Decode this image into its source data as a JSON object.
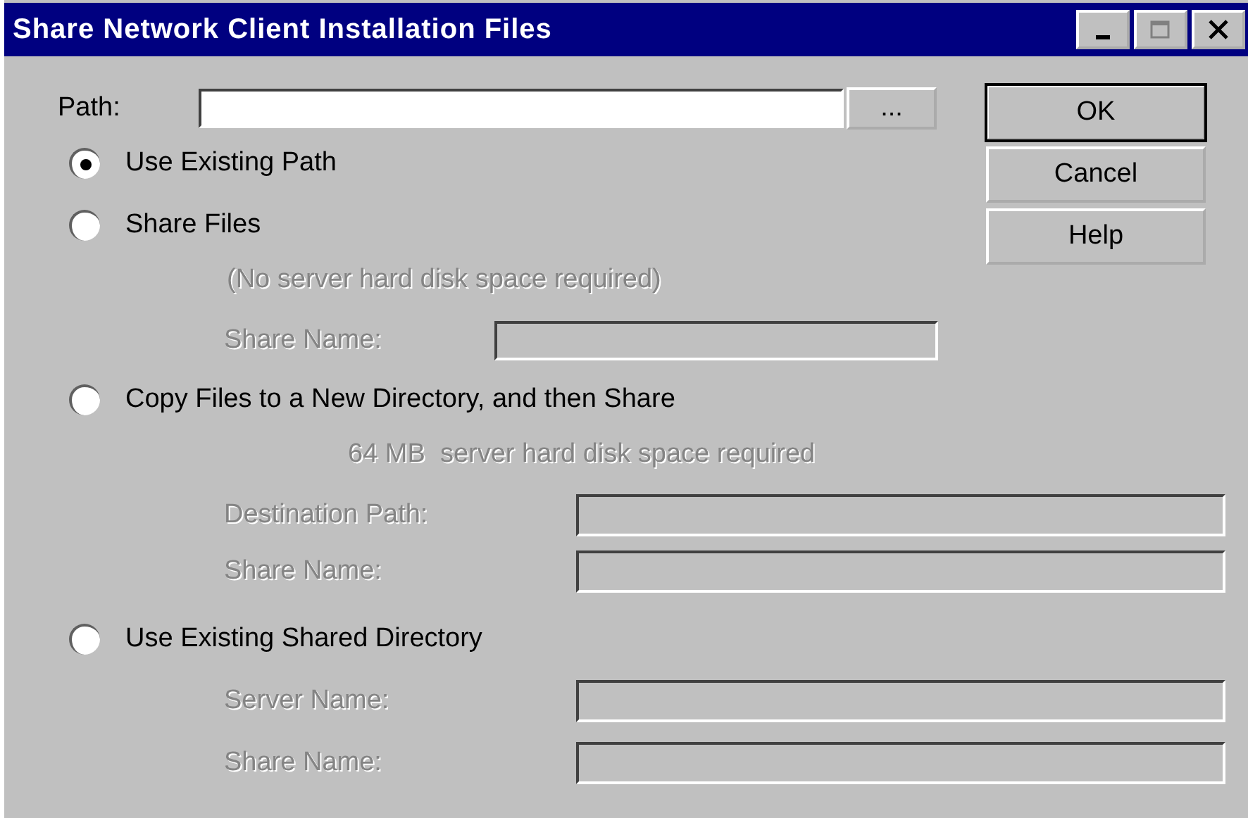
{
  "window": {
    "title": "Share Network Client Installation Files"
  },
  "path": {
    "label": "Path:",
    "browse_button": "..."
  },
  "options": [
    {
      "label": "Use Existing Path",
      "selected": true
    },
    {
      "label": "Share Files",
      "selected": false,
      "note": "(No server hard disk space required)",
      "fields": [
        {
          "label": "Share Name:",
          "disabled": true
        }
      ]
    },
    {
      "label": "Copy Files to a New Directory, and then Share",
      "selected": false,
      "note": "64 MB  server hard disk space required",
      "fields": [
        {
          "label": "Destination Path:",
          "disabled": true
        },
        {
          "label": "Share Name:",
          "disabled": true
        }
      ]
    },
    {
      "label": "Use Existing Shared Directory",
      "selected": false,
      "fields": [
        {
          "label": "Server Name:",
          "disabled": true
        },
        {
          "label": "Share Name:",
          "disabled": true
        }
      ]
    }
  ],
  "buttons": [
    {
      "label": "OK",
      "default": true
    },
    {
      "label": "Cancel",
      "default": false
    },
    {
      "label": "Help",
      "default": false
    }
  ]
}
